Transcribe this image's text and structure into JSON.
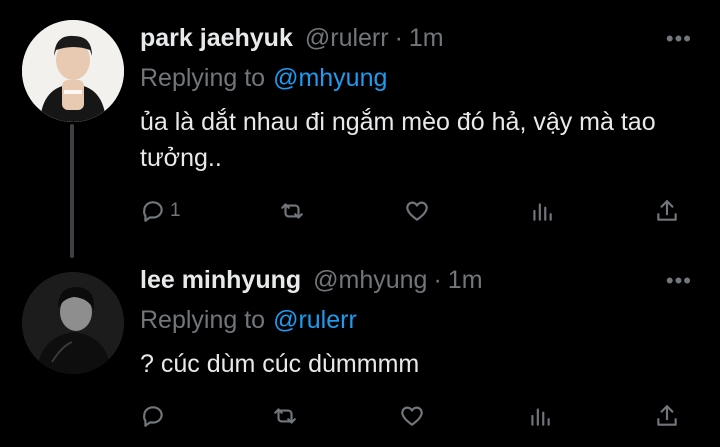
{
  "tweets": [
    {
      "name": "park jaehyuk",
      "handle": "@rulerr",
      "separator": "·",
      "time": "1m",
      "replying_to_label": "Replying to",
      "replying_to_handle": "@mhyung",
      "text": "ủa là dắt nhau đi ngắm mèo đó hả, vậy mà tao tưởng..",
      "reply_count": "1",
      "more_glyph": "•••"
    },
    {
      "name": "lee minhyung",
      "handle": "@mhyung",
      "separator": "·",
      "time": "1m",
      "replying_to_label": "Replying to",
      "replying_to_handle": "@rulerr",
      "text": "? cúc dùm cúc dùmmmm",
      "reply_count": "",
      "more_glyph": "•••"
    }
  ],
  "colors": {
    "background": "#000000",
    "text_primary": "#e7e9ea",
    "text_secondary": "#71767b",
    "link": "#1d9bf0"
  },
  "icons": [
    "reply-icon",
    "retweet-icon",
    "like-icon",
    "views-icon",
    "share-icon",
    "more-icon"
  ]
}
